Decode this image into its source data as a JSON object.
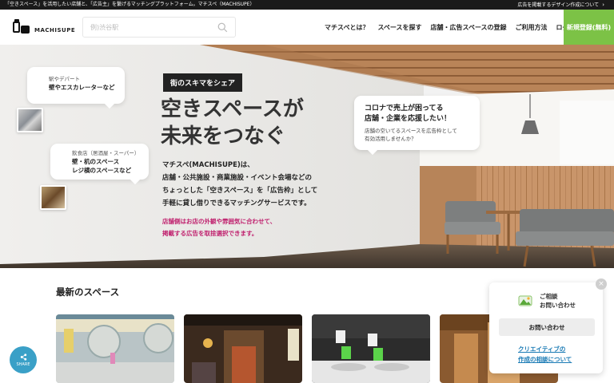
{
  "topbar": {
    "left_text": "「空きスペース」を活用したい店舗と、「広告主」を繋げるマッチングプラットフォーム。マチスペ（MACHISUPE）",
    "right_text": "広告を掲載するデザイン作成について",
    "right_chevron": "chevron-right-icon"
  },
  "header": {
    "logo_text": "MACHISUPE",
    "search_placeholder": "例)渋谷駅",
    "nav": [
      "マチスペとは？",
      "スペースを探す",
      "店舗・広告スペースの登録",
      "ご利用方法",
      "ログイン"
    ],
    "signup_label": "新規登録(無料)",
    "signup_color": "#7cc246"
  },
  "hero": {
    "tag": "街のスキマをシェア",
    "headline_line1": "空きスペースが",
    "headline_line2": "未来をつなぐ",
    "desc": [
      "マチスペ(MACHISUPE)は、",
      "店舗・公共施設・商業施設・イベント会場などの",
      "ちょっとした「空きスペース」を「広告枠」として",
      "手軽に貸し借りできるマッチングサービスです。"
    ],
    "desc_accent": [
      "店舗側はお店の外観や雰囲気に合わせて、",
      "掲載する広告を取捨選択できます。"
    ],
    "accent_color": "#c0226f",
    "bubble_station": {
      "small": "駅やデパート",
      "strong": "壁やエスカレーターなど"
    },
    "bubble_restaurant": {
      "small": "飲食店（居酒屋・スーパー）",
      "strong_line1": "壁・机のスペース",
      "strong_line2": "レジ横のスペースなど"
    },
    "bubble_corona": {
      "big_line1": "コロナで売上が困ってる",
      "big_line2": "店舗・企業を応援したい！",
      "note_line1": "店舗の空いてるスペースを広告枠として",
      "note_line2": "有効活用しませんか？"
    }
  },
  "latest": {
    "title": "最新のスペース"
  },
  "share": {
    "label": "SHARE",
    "color": "#3aa0c7"
  },
  "widget": {
    "head_line1": "ご相談",
    "head_line2": "お問い合わせ",
    "button": "お問い合わせ",
    "link_line1": "クリエイティブの",
    "link_line2": "作成の相談について",
    "link_color": "#1b7bb5",
    "close": "×"
  }
}
